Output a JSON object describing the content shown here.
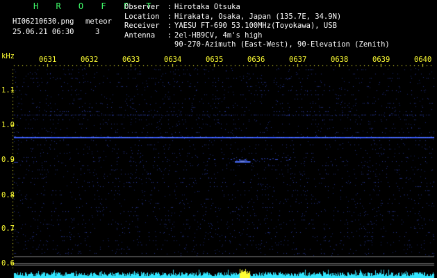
{
  "app": {
    "title": "H R O F F T",
    "filename": "HI06210630.png",
    "datetime": "25.06.21 06:30",
    "meteor_label": "meteor",
    "meteor_count": "3"
  },
  "station": {
    "observer": {
      "label": "Observer",
      "value": "Hirotaka Otsuka"
    },
    "location": {
      "label": "Location",
      "value": "Hirakata, Osaka, Japan (135.7E, 34.9N)"
    },
    "receiver": {
      "label": "Receiver",
      "value": "YAESU FT-690 53.100MHz(Toyokawa), USB"
    },
    "antenna": {
      "label": "Antenna",
      "value": "2el-HB9CV, 4m's high",
      "value2": "90-270-Azimuth (East-West), 90-Elevation (Zenith)"
    }
  },
  "axis": {
    "unit": "kHz",
    "time_ticks": [
      "0631",
      "0632",
      "0633",
      "0634",
      "0635",
      "0636",
      "0637",
      "0638",
      "0639",
      "0640"
    ],
    "freq_ticks": [
      "1.1",
      "1.0",
      "0.9",
      "0.8",
      "0.7",
      "0.6"
    ]
  },
  "colors": {
    "background": "#000000",
    "signal": "#3a5cff",
    "grid_dots": "#2a3a9a",
    "tick_text": "#ffff33",
    "title_green": "#3fff6a",
    "meter_cyan": "#33e6ff",
    "meter_yellow": "#ffff33"
  },
  "signal": {
    "carrier_freq_khz": 0.966,
    "meteor_echo": {
      "time": "0635.5",
      "freq_khz": 0.895
    }
  }
}
